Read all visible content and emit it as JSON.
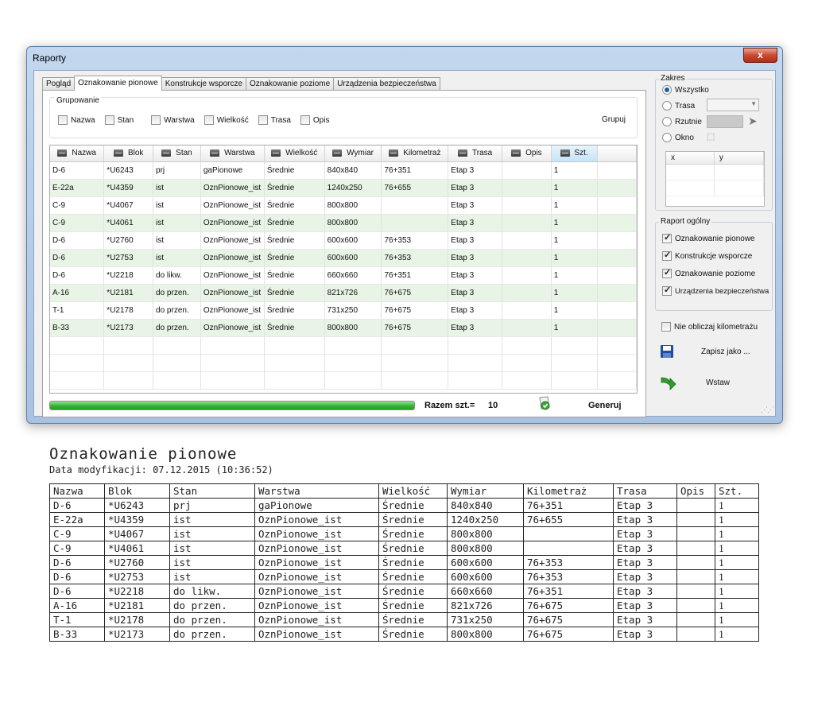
{
  "window": {
    "title": "Raporty",
    "close_label": "x"
  },
  "tabs": [
    {
      "label": "Pogląd",
      "active": false
    },
    {
      "label": "Oznakowanie pionowe",
      "active": true
    },
    {
      "label": "Konstrukcje wsporcze",
      "active": false
    },
    {
      "label": "Oznakowanie poziome",
      "active": false
    },
    {
      "label": "Urządzenia bezpieczeństwa",
      "active": false
    }
  ],
  "grouping": {
    "title": "Grupowanie",
    "options": [
      {
        "label": "Nazwa",
        "checked": false
      },
      {
        "label": "Stan",
        "checked": false
      },
      {
        "label": "Warstwa",
        "checked": false
      },
      {
        "label": "Wielkość",
        "checked": false
      },
      {
        "label": "Trasa",
        "checked": false
      },
      {
        "label": "Opis",
        "checked": false
      }
    ],
    "group_button": "Grupuj"
  },
  "grid": {
    "columns": [
      "Nazwa",
      "Blok",
      "Stan",
      "Warstwa",
      "Wielkość",
      "Wymiar",
      "Kilometraż",
      "Trasa",
      "Opis",
      "Szt."
    ],
    "rows": [
      [
        "D-6",
        "*U6243",
        "prj",
        "gaPionowe",
        "Średnie",
        "840x840",
        "76+351",
        "Etap 3",
        "",
        "1"
      ],
      [
        "E-22a",
        "*U4359",
        "ist",
        "OznPionowe_ist",
        "Średnie",
        "1240x250",
        "76+655",
        "Etap 3",
        "",
        "1"
      ],
      [
        "C-9",
        "*U4067",
        "ist",
        "OznPionowe_ist",
        "Średnie",
        "800x800",
        "",
        "Etap 3",
        "",
        "1"
      ],
      [
        "C-9",
        "*U4061",
        "ist",
        "OznPionowe_ist",
        "Średnie",
        "800x800",
        "",
        "Etap 3",
        "",
        "1"
      ],
      [
        "D-6",
        "*U2760",
        "ist",
        "OznPionowe_ist",
        "Średnie",
        "600x600",
        "76+353",
        "Etap 3",
        "",
        "1"
      ],
      [
        "D-6",
        "*U2753",
        "ist",
        "OznPionowe_ist",
        "Średnie",
        "600x600",
        "76+353",
        "Etap 3",
        "",
        "1"
      ],
      [
        "D-6",
        "*U2218",
        "do likw.",
        "OznPionowe_ist",
        "Średnie",
        "660x660",
        "76+351",
        "Etap 3",
        "",
        "1"
      ],
      [
        "A-16",
        "*U2181",
        "do przen.",
        "OznPionowe_ist",
        "Średnie",
        "821x726",
        "76+675",
        "Etap 3",
        "",
        "1"
      ],
      [
        "T-1",
        "*U2178",
        "do przen.",
        "OznPionowe_ist",
        "Średnie",
        "731x250",
        "76+675",
        "Etap 3",
        "",
        "1"
      ],
      [
        "B-33",
        "*U2173",
        "do przen.",
        "OznPionowe_ist",
        "Średnie",
        "800x800",
        "76+675",
        "Etap 3",
        "",
        "1"
      ]
    ]
  },
  "footer": {
    "progress": 1.0,
    "total_label": "Razem szt.=",
    "total_value": "10",
    "generate_label": "Generuj"
  },
  "zakres": {
    "title": "Zakres",
    "options": [
      {
        "label": "Wszystko",
        "selected": true
      },
      {
        "label": "Trasa",
        "selected": false
      },
      {
        "label": "Rzutnie",
        "selected": false
      },
      {
        "label": "Okno",
        "selected": false
      }
    ],
    "xy_columns": [
      "x",
      "y"
    ]
  },
  "raport_ogolny": {
    "title": "Raport ogólny",
    "options": [
      {
        "label": "Oznakowanie pionowe",
        "checked": true
      },
      {
        "label": "Konstrukcje wsporcze",
        "checked": true
      },
      {
        "label": "Oznakowanie poziome",
        "checked": true
      },
      {
        "label": "Urządzenia bezpieczeństwa",
        "checked": true
      }
    ]
  },
  "nie_obliczaj": {
    "label": "Nie obliczaj kilometrażu",
    "checked": false
  },
  "actions": {
    "save_label": "Zapisz jako ...",
    "insert_label": "Wstaw"
  },
  "colors": {
    "alt_row": "#e8f4e5",
    "progress": "#34b234",
    "close": "#c94a32"
  },
  "cad": {
    "title": "Oznakowanie pionowe",
    "subtitle_prefix": "Data modyfikacji:",
    "subtitle_value": "07.12.2015 (10:36:52)",
    "columns": [
      "Nazwa",
      "Blok",
      "Stan",
      "Warstwa",
      "Wielkość",
      "Wymiar",
      "Kilometraż",
      "Trasa",
      "Opis",
      "Szt."
    ],
    "rows": [
      [
        "D-6",
        "*U6243",
        "prj",
        "gaPionowe",
        "Średnie",
        "840x840",
        "76+351",
        "Etap 3",
        "",
        "1"
      ],
      [
        "E-22a",
        "*U4359",
        "ist",
        "OznPionowe_ist",
        "Średnie",
        "1240x250",
        "76+655",
        "Etap 3",
        "",
        "1"
      ],
      [
        "C-9",
        "*U4067",
        "ist",
        "OznPionowe_ist",
        "Średnie",
        "800x800",
        "",
        "Etap 3",
        "",
        "1"
      ],
      [
        "C-9",
        "*U4061",
        "ist",
        "OznPionowe_ist",
        "Średnie",
        "800x800",
        "",
        "Etap 3",
        "",
        "1"
      ],
      [
        "D-6",
        "*U2760",
        "ist",
        "OznPionowe_ist",
        "Średnie",
        "600x600",
        "76+353",
        "Etap 3",
        "",
        "1"
      ],
      [
        "D-6",
        "*U2753",
        "ist",
        "OznPionowe_ist",
        "Średnie",
        "600x600",
        "76+353",
        "Etap 3",
        "",
        "1"
      ],
      [
        "D-6",
        "*U2218",
        "do likw.",
        "OznPionowe_ist",
        "Średnie",
        "660x660",
        "76+351",
        "Etap 3",
        "",
        "1"
      ],
      [
        "A-16",
        "*U2181",
        "do przen.",
        "OznPionowe_ist",
        "Średnie",
        "821x726",
        "76+675",
        "Etap 3",
        "",
        "1"
      ],
      [
        "T-1",
        "*U2178",
        "do przen.",
        "OznPionowe_ist",
        "Średnie",
        "731x250",
        "76+675",
        "Etap 3",
        "",
        "1"
      ],
      [
        "B-33",
        "*U2173",
        "do przen.",
        "OznPionowe_ist",
        "Średnie",
        "800x800",
        "76+675",
        "Etap 3",
        "",
        "1"
      ]
    ]
  }
}
